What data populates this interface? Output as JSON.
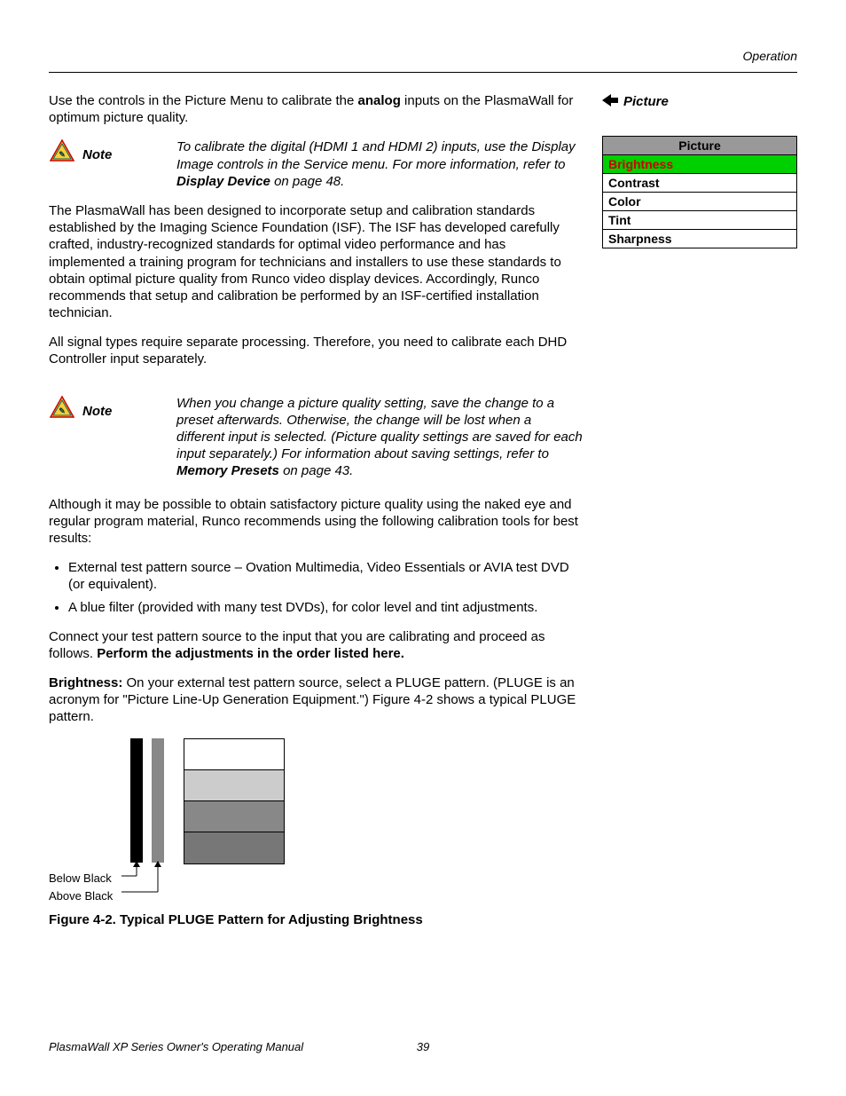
{
  "header": {
    "section": "Operation"
  },
  "side": {
    "heading": "Picture",
    "menu_title": "Picture",
    "items": [
      "Brightness",
      "Contrast",
      "Color",
      "Tint",
      "Sharpness"
    ],
    "selected_index": 0
  },
  "body": {
    "p1a": "Use the controls in the Picture Menu to calibrate the ",
    "p1b": "analog",
    "p1c": " inputs on the PlasmaWall for optimum picture quality.",
    "note1a": "To calibrate the digital (HDMI 1 and HDMI 2) inputs, use the Display Image controls in the Service menu. For more information, refer to ",
    "note1b": "Display Device",
    "note1c": " on page 48.",
    "p2": "The PlasmaWall has been designed to incorporate setup and calibration standards established by the Imaging Science Foundation (ISF). The ISF has developed carefully crafted, industry-recognized standards for optimal video performance and has implemented a training program for technicians and installers to use these standards to obtain optimal picture quality from Runco video display devices. Accordingly, Runco recommends that setup and calibration be performed by an ISF-certified installation technician.",
    "p3": "All signal types require separate processing. Therefore, you need to calibrate each DHD Controller input separately.",
    "note2a": "When you change a picture quality setting, save the change to a preset afterwards. Otherwise, the change will be lost when a different input is selected. (Picture quality settings are saved for each input separately.) For information about saving settings, refer to ",
    "note2b": "Memory Presets",
    "note2c": " on page 43.",
    "p4": "Although it may be possible to obtain satisfactory picture quality using the naked eye and regular program material, Runco recommends using the following calibration tools for best results:",
    "li1": "External test pattern source – Ovation Multimedia, Video Essentials or AVIA test DVD (or equivalent).",
    "li2": "A blue filter (provided with many test DVDs), for color level and tint adjustments.",
    "p5a": "Connect your test pattern source to the input that you are calibrating and proceed as follows. ",
    "p5b": "Perform the adjustments in the order listed here.",
    "p6a": "Brightness:",
    "p6b": " On your external test pattern source, select a PLUGE pattern. (PLUGE is an acronym for \"Picture Line-Up Generation Equipment.\") Figure 4-2 shows a typical PLUGE pattern.",
    "below_black": "Below Black",
    "above_black": "Above Black",
    "fig_caption": "Figure 4-2. Typical PLUGE Pattern for Adjusting Brightness",
    "note_label": "Note"
  },
  "footer": {
    "doc_title": "PlasmaWall XP Series Owner's Operating Manual",
    "page_num": "39"
  }
}
